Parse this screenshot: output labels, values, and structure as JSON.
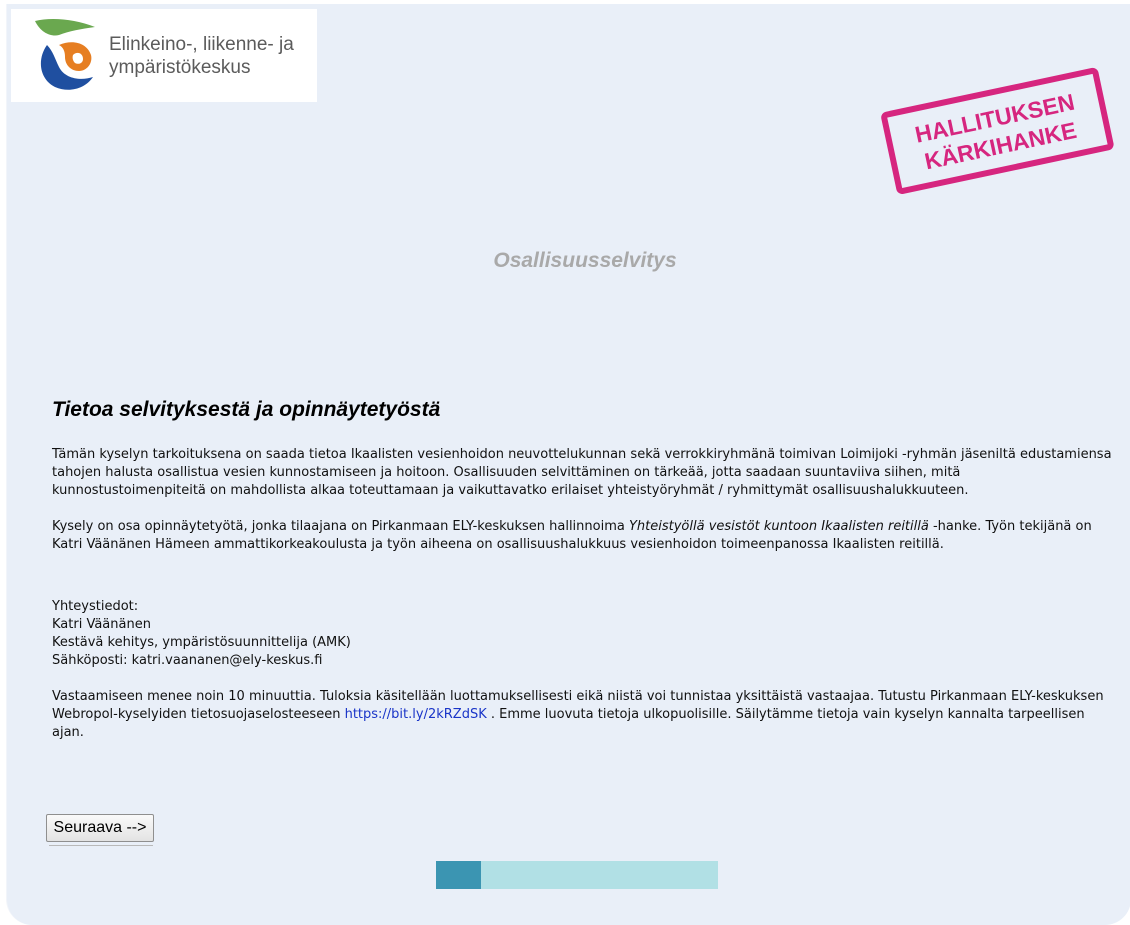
{
  "header": {
    "logo_line1": "Elinkeino-, liikenne- ja",
    "logo_line2": "ympäristökeskus",
    "stamp_line1": "HALLITUKSEN",
    "stamp_line2": "KÄRKIHANKE"
  },
  "survey_title": "Osallisuusselvitys",
  "section_heading": "Tietoa selvityksestä ja opinnäytetyöstä",
  "intro": "Tämän kyselyn tarkoituksena on saada tietoa Ikaalisten vesienhoidon neuvottelukunnan sekä verrokkiryhmänä toimivan Loimijoki -ryhmän jäseniltä edustamiensa tahojen halusta osallistua vesien kunnostamiseen ja hoitoon. Osallisuuden selvittäminen on tärkeää, jotta saadaan suuntaviiva siihen, mitä kunnostustoimenpiteitä on mahdollista alkaa toteuttamaan ja vaikuttavatko erilaiset yhteistyöryhmät / ryhmittymät osallisuushalukkuuteen.",
  "thesis": {
    "before": "Kysely on osa opinnäytetyötä, jonka tilaajana on Pirkanmaan ELY-keskuksen hallinnoima ",
    "project": "Yhteistyöllä vesistöt kuntoon Ikaalisten reitillä",
    "after": " -hanke. Työn tekijänä on Katri Väänänen Hämeen ammattikorkeakoulusta ja työn aiheena on osallisuushalukkuus vesienhoidon toimeenpanossa Ikaalisten reitillä."
  },
  "contact": {
    "heading": "Yhteystiedot:",
    "name": "Katri Väänänen",
    "title": "Kestävä kehitys, ympäristösuunnittelija (AMK)",
    "email": "Sähköposti: katri.vaananen@ely-keskus.fi"
  },
  "privacy": {
    "before": "Vastaamiseen menee noin 10 minuuttia. Tuloksia käsitellään luottamuksellisesti eikä niistä voi tunnistaa yksittäistä vastaajaa. Tutustu Pirkanmaan ELY-keskuksen Webropol-kyselyiden tietosuojaselosteeseen ",
    "link": "https://bit.ly/2kRZdSK",
    "after": " . Emme luovuta tietoja ulkopuolisille. Säilytämme tietoja vain kyselyn kannalta tarpeellisen ajan."
  },
  "next_button": "Seuraava -->",
  "progress": 0.16,
  "colors": {
    "background": "#e9eff8",
    "stamp": "#d6267f",
    "link": "#1a35c8",
    "progress_fill": "#3b95b2",
    "progress_track": "#b1e0e5"
  }
}
